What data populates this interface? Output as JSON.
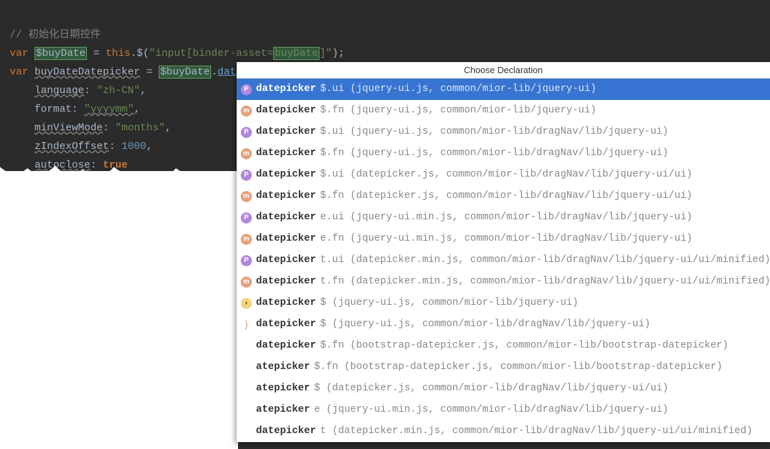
{
  "code": {
    "comment": "// 初始化日期控件",
    "var": "var",
    "buyDate": "$buyDate",
    "equals": " = ",
    "this": "this",
    "dot": ".",
    "dollar": "$",
    "openP": "(",
    "stringPrefix": "\"input[binder-asset=",
    "hlMatch": "buyDate",
    "stringSuffix": "]\"",
    "closePsemi": ");",
    "buyDateDatepicker": "buyDateDatepicker",
    "buyDateVar2": "$buyDate",
    "datepicker": "datepicker",
    "openBrace": "({",
    "langKey": "language",
    "langVal": "\"zh-CN\"",
    "formatKey": "format",
    "formatVal": "\"yyyymm\"",
    "minKey": "minViewMode",
    "minVal": "\"months\"",
    "zKey": "zIndexOffset",
    "zVal": "1000",
    "autoKey": "autoclose",
    "autoVal": "true",
    "closing": "});",
    "colon": ": ",
    "comma": ","
  },
  "popup": {
    "title": "Choose Declaration",
    "items": [
      {
        "icon": "p",
        "name": "datepicker",
        "detail": "$.ui (jquery-ui.js, common/mior-lib/jquery-ui)",
        "selected": true
      },
      {
        "icon": "m",
        "name": "datepicker",
        "detail": "$.fn (jquery-ui.js, common/mior-lib/jquery-ui)"
      },
      {
        "icon": "p",
        "name": "datepicker",
        "detail": "$.ui (jquery-ui.js, common/mior-lib/dragNav/lib/jquery-ui)"
      },
      {
        "icon": "m",
        "name": "datepicker",
        "detail": "$.fn (jquery-ui.js, common/mior-lib/dragNav/lib/jquery-ui)"
      },
      {
        "icon": "p",
        "name": "datepicker",
        "detail": "$.ui (datepicker.js, common/mior-lib/dragNav/lib/jquery-ui/ui)"
      },
      {
        "icon": "m",
        "name": "datepicker",
        "detail": "$.fn (datepicker.js, common/mior-lib/dragNav/lib/jquery-ui/ui)"
      },
      {
        "icon": "p",
        "name": "datepicker",
        "detail": "e.ui (jquery-ui.min.js, common/mior-lib/dragNav/lib/jquery-ui)"
      },
      {
        "icon": "m",
        "name": "datepicker",
        "detail": "e.fn (jquery-ui.min.js, common/mior-lib/dragNav/lib/jquery-ui)"
      },
      {
        "icon": "p",
        "name": "datepicker",
        "detail": "t.ui (datepicker.min.js, common/mior-lib/dragNav/lib/jquery-ui/ui/minified)"
      },
      {
        "icon": "m",
        "name": "datepicker",
        "detail": "t.fn (datepicker.min.js, common/mior-lib/dragNav/lib/jquery-ui/ui/minified)"
      },
      {
        "icon": "j",
        "name": "datepicker",
        "detail": "$ (jquery-ui.js, common/mior-lib/jquery-ui)"
      },
      {
        "icon": "paren",
        "name": "datepicker",
        "detail": "$ (jquery-ui.js, common/mior-lib/dragNav/lib/jquery-ui)"
      },
      {
        "icon": "none",
        "name": "datepicker",
        "detail": "$.fn (bootstrap-datepicker.js, common/mior-lib/bootstrap-datepicker)"
      },
      {
        "icon": "none",
        "name": "atepicker",
        "detail": "$.fn (bootstrap-datepicker.js, common/mior-lib/bootstrap-datepicker)"
      },
      {
        "icon": "none",
        "name": "atepicker",
        "detail": "$ (datepicker.js, common/mior-lib/dragNav/lib/jquery-ui/ui)"
      },
      {
        "icon": "none",
        "name": "atepicker",
        "detail": "e (jquery-ui.min.js, common/mior-lib/dragNav/lib/jquery-ui)"
      },
      {
        "icon": "none",
        "name": "datepicker",
        "detail": "t (datepicker.min.js, common/mior-lib/dragNav/lib/jquery-ui/ui/minified)"
      }
    ]
  }
}
